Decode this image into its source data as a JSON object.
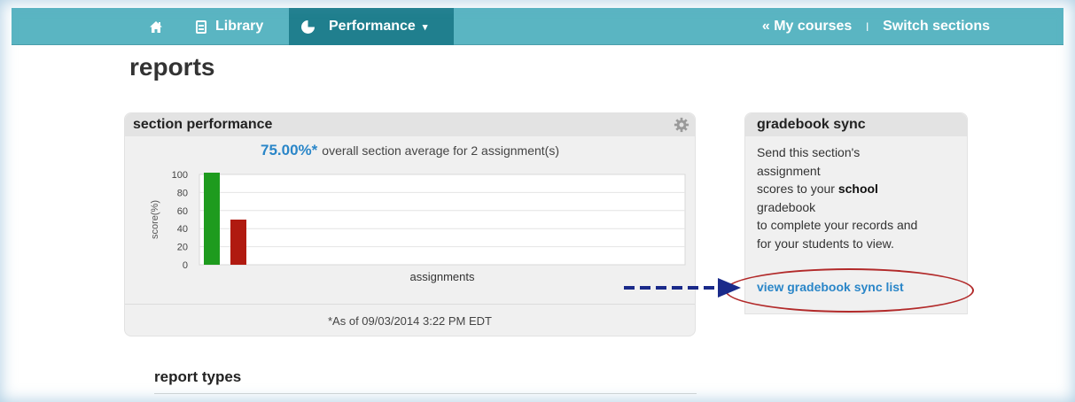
{
  "nav": {
    "home_icon": "home-icon",
    "library_label": "Library",
    "library_icon": "document-icon",
    "performance_label": "Performance",
    "performance_icon": "pie-chart-icon",
    "performance_caret": "▾",
    "my_courses_label": "« My courses",
    "separator": "|",
    "switch_sections_label": "Switch sections",
    "bar_color": "#5ab5c2",
    "active_color": "#207f8e"
  },
  "page": {
    "title": "reports"
  },
  "section_performance": {
    "header": "section performance",
    "settings_icon": "gear-icon",
    "average_value": "75.00%*",
    "average_text": "overall section average for 2 assignment(s)",
    "as_of": "*As of 09/03/2014 3:22 PM EDT",
    "accent_color": "#2a86c8"
  },
  "chart_data": {
    "type": "bar",
    "categories": [
      "",
      ""
    ],
    "values": [
      100,
      50
    ],
    "colors": [
      "#1e9b1e",
      "#b01a10"
    ],
    "title": "",
    "xlabel": "assignments",
    "ylabel": "score(%)",
    "ylim": [
      0,
      100
    ],
    "yticks": [
      0,
      20,
      40,
      60,
      80,
      100
    ],
    "grid": true
  },
  "gradebook_sync": {
    "header": "gradebook sync",
    "line1": "Send this section's",
    "line2": "assignment",
    "line3_pre": "scores to your",
    "line3_bold": "school",
    "line4": "gradebook",
    "line5": "to complete your records and",
    "line6": "for your students to view.",
    "link_label": "view gradebook sync list",
    "annotation_color": "#b22a2a",
    "arrow_color": "#1a2a8a"
  },
  "report_types": {
    "heading": "report types"
  }
}
